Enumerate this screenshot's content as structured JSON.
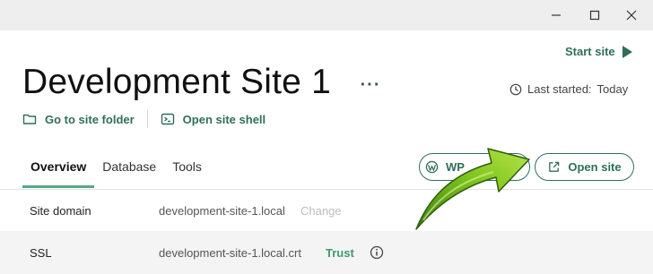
{
  "window": {
    "controls": [
      "minimize-icon",
      "maximize-icon",
      "close-icon"
    ]
  },
  "header": {
    "start_site_label": "Start site",
    "title": "Development Site 1",
    "more_label": "···",
    "last_started_label": "Last started:",
    "last_started_value": "Today"
  },
  "site_actions": [
    {
      "label": "Go to site folder",
      "icon": "folder-icon"
    },
    {
      "label": "Open site shell",
      "icon": "terminal-icon"
    }
  ],
  "tabs": [
    {
      "label": "Overview",
      "active": true
    },
    {
      "label": "Database",
      "active": false
    },
    {
      "label": "Tools",
      "active": false
    }
  ],
  "buttons": {
    "wp_admin_label": "WP",
    "open_site_label": "Open site"
  },
  "overview": {
    "site_domain_label": "Site domain",
    "site_domain_value": "development-site-1.local",
    "change_label": "Change",
    "ssl_label": "SSL",
    "ssl_value": "development-site-1.local.crt",
    "trust_label": "Trust"
  },
  "colors": {
    "accent": "#2f6f58",
    "tab_underline": "#56aa86",
    "arrow": "#7cc41c"
  }
}
